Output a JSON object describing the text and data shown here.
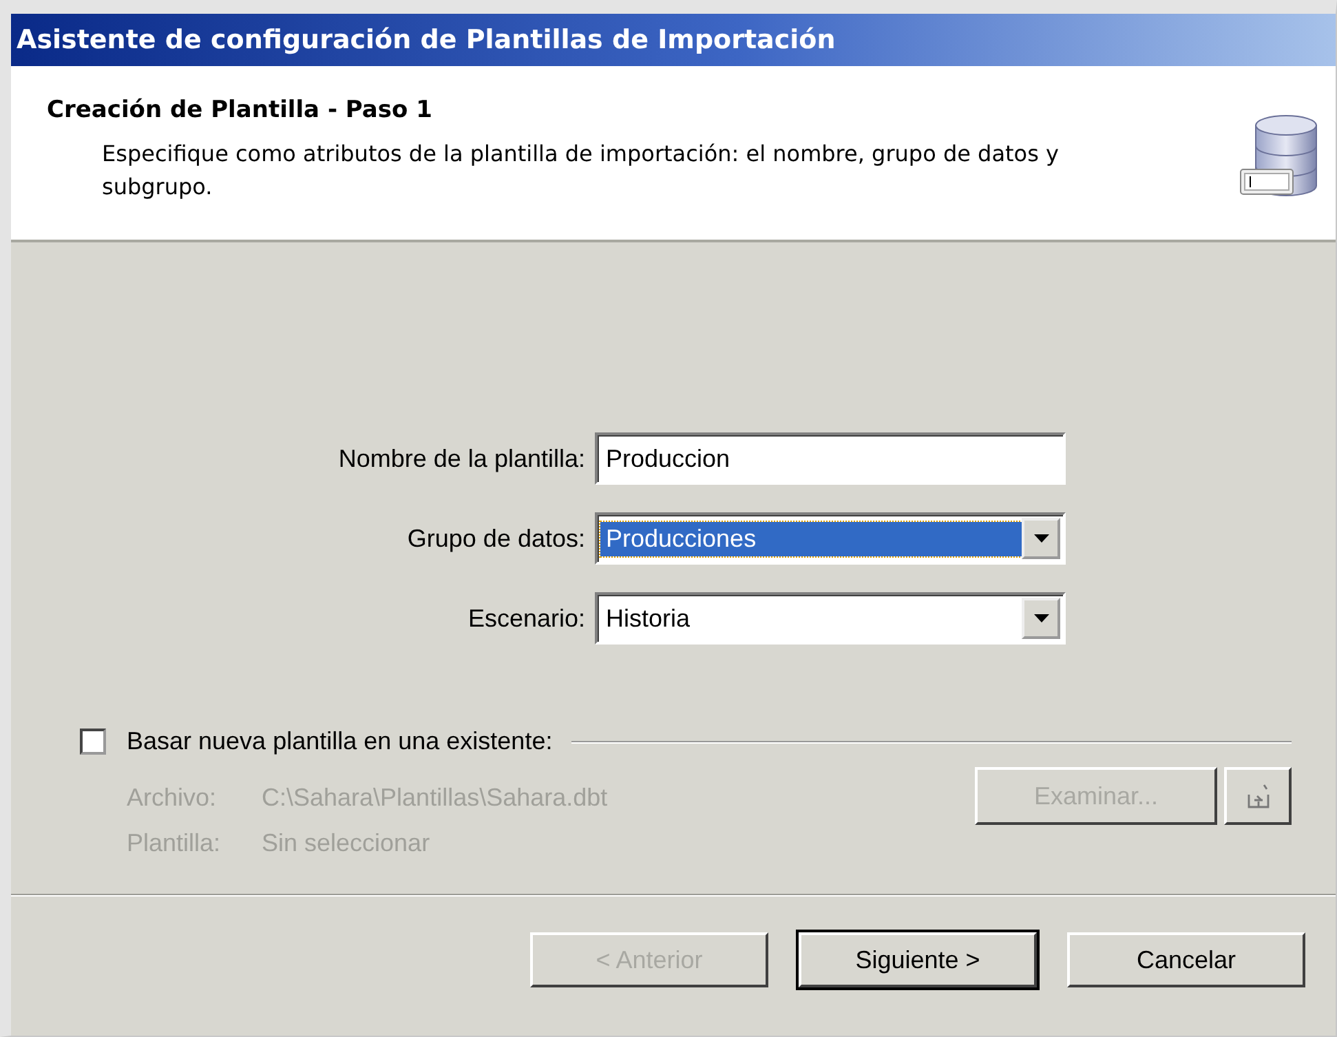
{
  "window": {
    "title": "Asistente de configuración de Plantillas de Importación"
  },
  "header": {
    "title": "Creación de Plantilla - Paso 1",
    "description": "Especifique como atributos de la plantilla de importación: el nombre, grupo de datos y subgrupo."
  },
  "fields": [
    {
      "kind": "text",
      "label": "Nombre de la plantilla:",
      "value": "Produccion",
      "selected": false
    },
    {
      "kind": "dropdown",
      "label": "Grupo de datos:",
      "value": "Producciones",
      "selected": true
    },
    {
      "kind": "dropdown",
      "label": "Escenario:",
      "value": "Historia",
      "selected": false
    }
  ],
  "base_template": {
    "label": "Basar nueva plantilla en una existente:",
    "checked": false,
    "disabled": true,
    "rows": [
      {
        "label": "Archivo:",
        "value": "C:\\Sahara\\Plantillas\\Sahara.dbt"
      },
      {
        "label": "Plantilla:",
        "value": "Sin seleccionar"
      }
    ],
    "browse_button": "Examinar..."
  },
  "buttons": [
    {
      "label": "< Anterior",
      "disabled": true,
      "default": false
    },
    {
      "label": "Siguiente >",
      "disabled": false,
      "default": true
    },
    {
      "label": "Cancelar",
      "disabled": false,
      "default": false
    }
  ]
}
